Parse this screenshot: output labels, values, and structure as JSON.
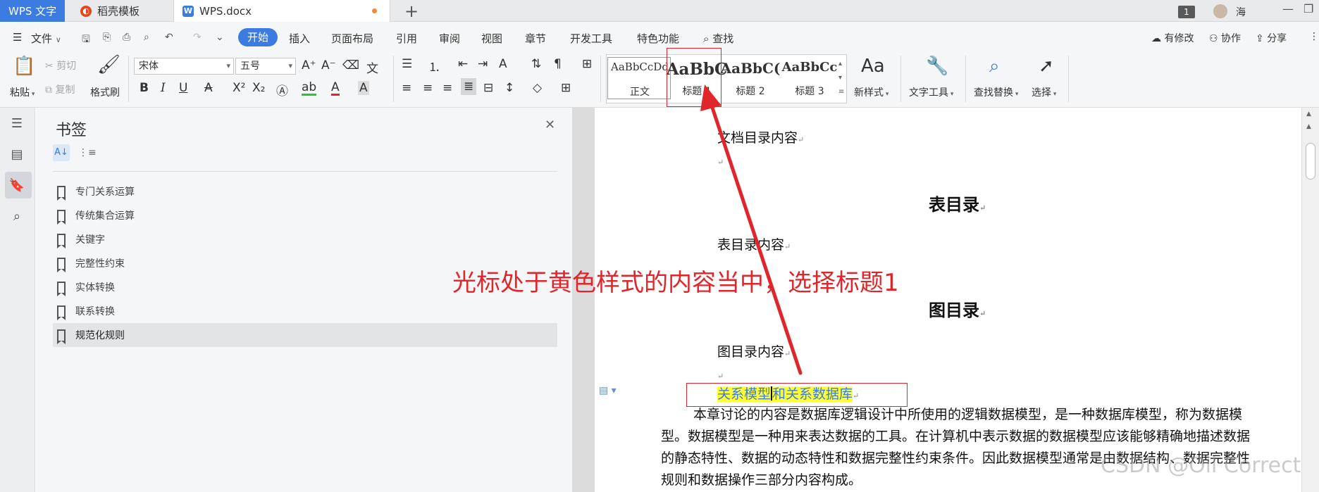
{
  "tabs": {
    "app": "WPS 文字",
    "template": "稻壳模板",
    "document": "WPS.docx",
    "new_tab": "+"
  },
  "window": {
    "badge": "1",
    "user": "海",
    "minimize": "—",
    "restore": "❐"
  },
  "menu": {
    "file": "文件",
    "start": "开始",
    "insert": "插入",
    "layout": "页面布局",
    "reference": "引用",
    "review": "审阅",
    "view": "视图",
    "section": "章节",
    "devtools": "开发工具",
    "special": "特色功能",
    "search": "查找",
    "modified": "有修改",
    "collab": "协作",
    "share": "分享"
  },
  "ribbon": {
    "paste": "粘贴",
    "cut": "剪切",
    "copy": "复制",
    "format_painter": "格式刷",
    "font_name": "宋体",
    "font_size": "五号",
    "styles": [
      {
        "sample": "AaBbCcDd",
        "label": "正文"
      },
      {
        "sample": "AaBbC",
        "label": "标题 1"
      },
      {
        "sample": "AaBbC(",
        "label": "标题 2"
      },
      {
        "sample": "AaBbCc",
        "label": "标题 3"
      }
    ],
    "new_style": "新样式",
    "text_tools": "文字工具",
    "find_replace": "查找替换",
    "select": "选择"
  },
  "bookmarks": {
    "title": "书签",
    "items": [
      "专门关系运算",
      "传统集合运算",
      "关键字",
      "完整性约束",
      "实体转换",
      "联系转换",
      "规范化规则"
    ],
    "selected_index": 6
  },
  "document": {
    "toc_content": "文档目录内容",
    "table_toc_heading": "表目录",
    "table_toc_content": "表目录内容",
    "figure_toc_heading": "图目录",
    "figure_toc_content": "图目录内容",
    "heading_part1": "关系模型",
    "heading_part2": "和关系数据库",
    "body": "本章讨论的内容是数据库逻辑设计中所使用的逻辑数据模型，是一种数据库模型，称为数据模型。数据模型是一种用来表达数据的工具。在计算机中表示数据的数据模型应该能够精确地描述数据的静态特性、数据的动态特性和数据完整性约束条件。因此数据模型通常是由数据结构、数据完整性规则和数据操作三部分内容构成。",
    "para_mark": "↵"
  },
  "annotation": {
    "text": "光标处于黄色样式的内容当中，选择标题1",
    "color": "#e0262a"
  },
  "watermark": "CSDN @Oil Correct"
}
